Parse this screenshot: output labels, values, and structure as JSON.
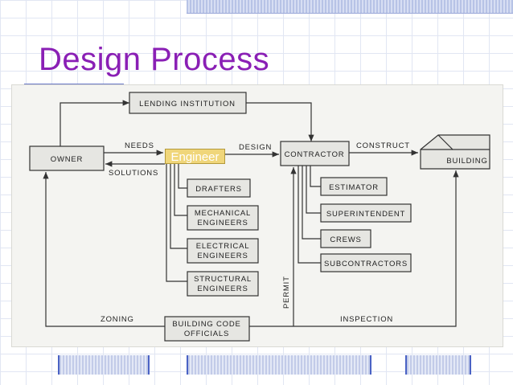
{
  "slide": {
    "title": "Design Process"
  },
  "diagram": {
    "engineer": "Engineer",
    "lending_institution": "LENDING INSTITUTION",
    "owner": "OWNER",
    "contractor": "CONTRACTOR",
    "building": "BUILDING",
    "drafters": "DRAFTERS",
    "mechanical": [
      "MECHANICAL",
      "ENGINEERS"
    ],
    "electrical": [
      "ELECTRICAL",
      "ENGINEERS"
    ],
    "structural": [
      "STRUCTURAL",
      "ENGINEERS"
    ],
    "estimator": "ESTIMATOR",
    "superintendent": "SUPERINTENDENT",
    "crews": "CREWS",
    "subcontractors": "SUBCONTRACTORS",
    "building_code": [
      "BUILDING CODE",
      "OFFICIALS"
    ],
    "needs": "NEEDS",
    "solutions": "SOLUTIONS",
    "design": "DESIGN",
    "construct": "CONSTRUCT",
    "zoning": "ZONING",
    "permit": "PERMIT",
    "inspection": "INSPECTION"
  }
}
